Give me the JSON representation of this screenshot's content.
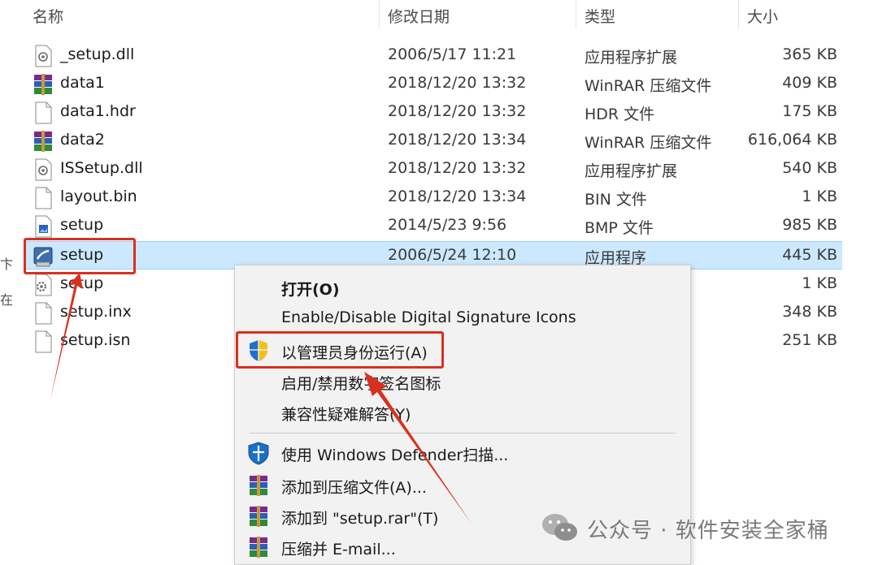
{
  "columns": {
    "name": "名称",
    "date": "修改日期",
    "type": "类型",
    "size": "大小"
  },
  "files": [
    {
      "name": "_setup.dll",
      "date": "2006/5/17 11:21",
      "type": "应用程序扩展",
      "size": "365 KB",
      "icon": "dll-file-icon"
    },
    {
      "name": "data1",
      "date": "2018/12/20 13:32",
      "type": "WinRAR 压缩文件",
      "size": "409 KB",
      "icon": "winrar-archive-icon"
    },
    {
      "name": "data1.hdr",
      "date": "2018/12/20 13:32",
      "type": "HDR 文件",
      "size": "175 KB",
      "icon": "blank-file-icon"
    },
    {
      "name": "data2",
      "date": "2018/12/20 13:34",
      "type": "WinRAR 压缩文件",
      "size": "616,064 KB",
      "icon": "winrar-archive-icon"
    },
    {
      "name": "ISSetup.dll",
      "date": "2018/12/20 13:32",
      "type": "应用程序扩展",
      "size": "540 KB",
      "icon": "dll-file-icon"
    },
    {
      "name": "layout.bin",
      "date": "2018/12/20 13:34",
      "type": "BIN 文件",
      "size": "1 KB",
      "icon": "blank-file-icon"
    },
    {
      "name": "setup",
      "date": "2014/5/23 9:56",
      "type": "BMP 文件",
      "size": "985 KB",
      "icon": "bitmap-file-icon"
    },
    {
      "name": "setup",
      "date": "2006/5/24 12:10",
      "type": "应用程序",
      "size": "445 KB",
      "icon": "setup-installer-icon",
      "selected": true
    },
    {
      "name": "setup",
      "date": "",
      "type": "",
      "size": "1 KB",
      "icon": "config-settings-icon"
    },
    {
      "name": "setup.inx",
      "date": "",
      "type": "",
      "size": "348 KB",
      "icon": "blank-file-icon"
    },
    {
      "name": "setup.isn",
      "date": "",
      "type": "",
      "size": "251 KB",
      "icon": "blank-file-icon"
    }
  ],
  "context_menu": {
    "open": "打开(O)",
    "digital_sig_en": "Enable/Disable Digital Signature Icons",
    "run_as_admin": "以管理员身份运行(A)",
    "digital_sig_cn": "启用/禁用数字签名图标",
    "compat": "兼容性疑难解答(Y)",
    "defender": "使用 Windows Defender扫描...",
    "add_archive": "添加到压缩文件(A)...",
    "add_setup_rar": "添加到 \"setup.rar\"(T)",
    "compress_email": "压缩并 E-mail..."
  },
  "watermark": {
    "text": "公众号 · 软件安装全家桶"
  },
  "edge_text": [
    "卞",
    "在"
  ],
  "colors": {
    "selection": "#cce8ff",
    "highlight_red": "#d9301e",
    "uac_blue": "#1f6fd1",
    "uac_yellow": "#f5c01a"
  }
}
